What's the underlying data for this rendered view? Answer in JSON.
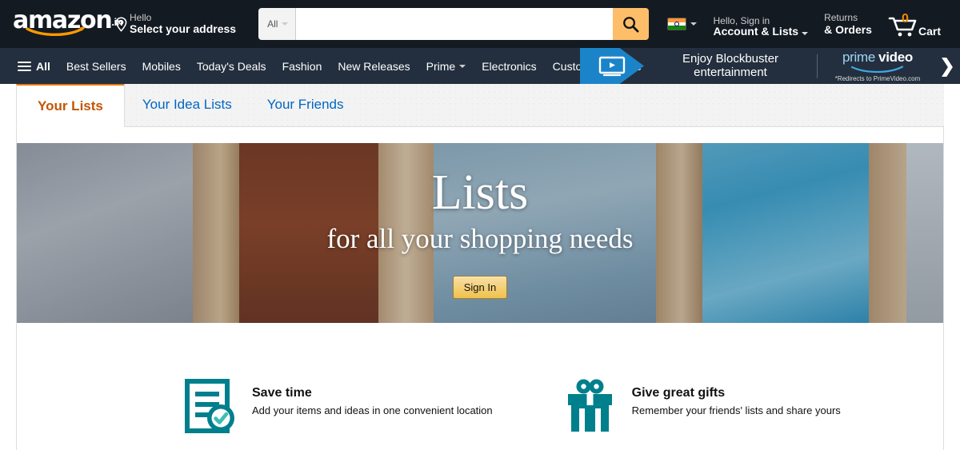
{
  "header": {
    "logo_word": "amazon",
    "logo_tld": ".in",
    "location": {
      "line1": "Hello",
      "line2": "Select your address",
      "icon": "location-pin-icon"
    },
    "search": {
      "category": "All",
      "value": "",
      "placeholder": "",
      "icon": "search-icon"
    },
    "flag": {
      "country": "India",
      "icon": "india-flag-icon"
    },
    "account": {
      "line1": "Hello, Sign in",
      "line2": "Account & Lists"
    },
    "returns": {
      "line1": "Returns",
      "line2": "& Orders"
    },
    "cart": {
      "count": "0",
      "label": "Cart",
      "icon": "shopping-cart-icon"
    }
  },
  "nav": {
    "all_label": "All",
    "items": [
      {
        "label": "Best Sellers"
      },
      {
        "label": "Mobiles"
      },
      {
        "label": "Today's Deals"
      },
      {
        "label": "Fashion"
      },
      {
        "label": "New Releases"
      },
      {
        "label": "Prime",
        "has_caret": true
      },
      {
        "label": "Electronics"
      },
      {
        "label": "Customer Service"
      }
    ],
    "promo": {
      "headline_line1": "Enjoy Blockbuster",
      "headline_line2": "entertainment",
      "brand_prime": "prime",
      "brand_video": "video",
      "note": "*Redirects to PrimeVideo.com",
      "tv_icon": "tv-play-icon",
      "chevron": "❯"
    }
  },
  "tabs": [
    {
      "label": "Your Lists",
      "active": true
    },
    {
      "label": "Your Idea Lists",
      "active": false
    },
    {
      "label": "Your Friends",
      "active": false
    }
  ],
  "hero": {
    "title": "Lists",
    "subtitle": "for all your shopping needs",
    "signin_label": "Sign In"
  },
  "features": [
    {
      "icon": "document-check-icon",
      "heading": "Save time",
      "description": "Add your items and ideas in one convenient location"
    },
    {
      "icon": "gift-box-icon",
      "heading": "Give great gifts",
      "description": "Remember your friends' lists and share yours"
    }
  ],
  "colors": {
    "header_bg": "#131A22",
    "nav_bg": "#232F3E",
    "accent_orange": "#FEBD69",
    "active_tab": "#C45500",
    "tab_border": "#E47911",
    "link_blue": "#0066C0",
    "feature_teal": "#007F8C",
    "promo_blue": "#1B84C9"
  }
}
